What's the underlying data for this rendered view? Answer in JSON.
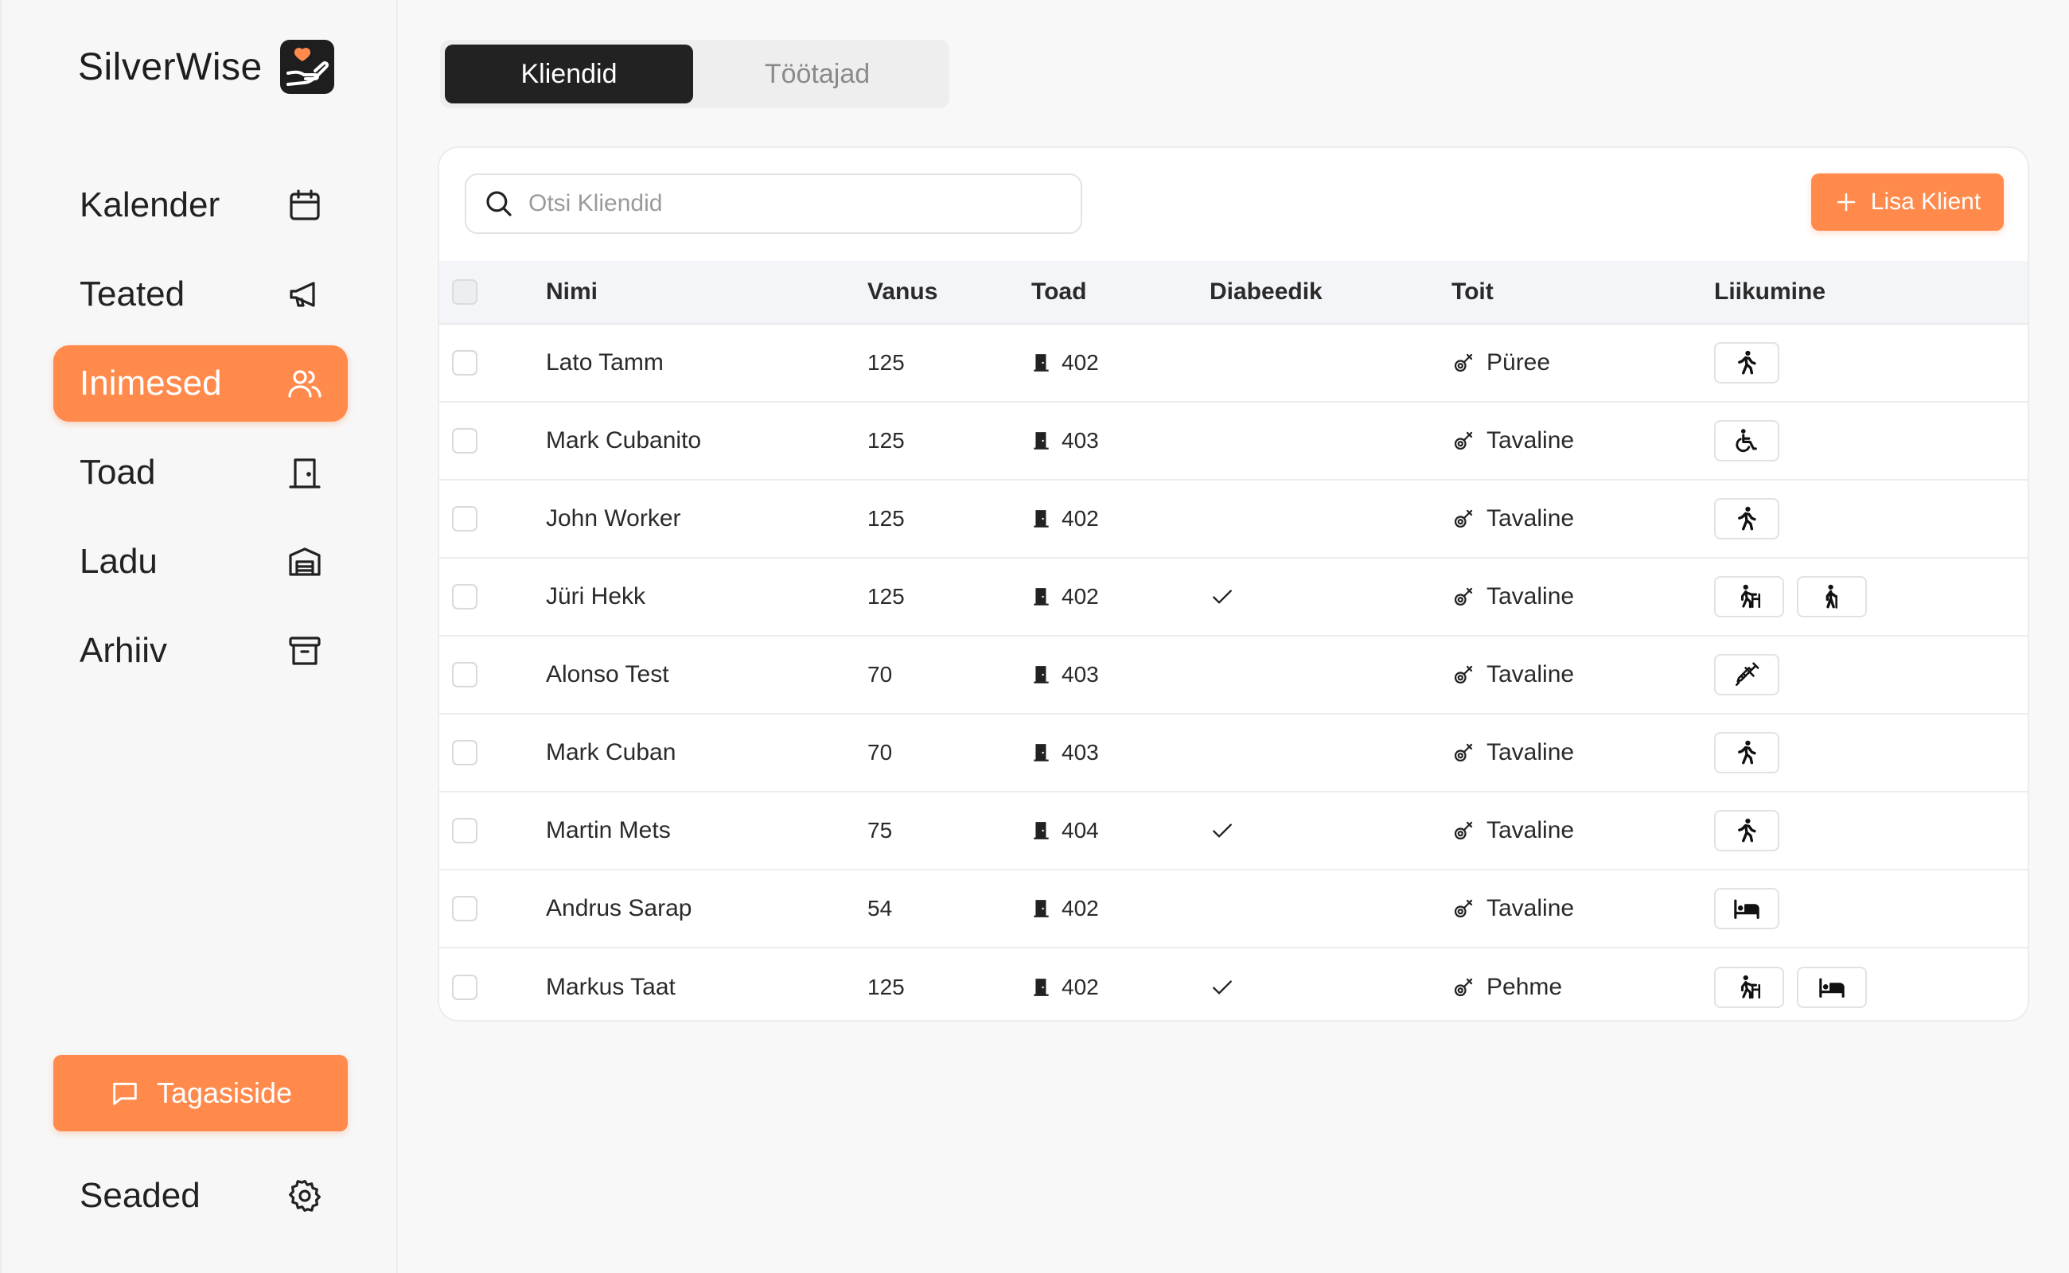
{
  "brand": {
    "name": "SilverWise"
  },
  "nav": [
    {
      "label": "Kalender",
      "icon": "calendar-icon"
    },
    {
      "label": "Teated",
      "icon": "megaphone-icon"
    },
    {
      "label": "Inimesed",
      "icon": "users-icon",
      "active": true
    },
    {
      "label": "Toad",
      "icon": "door-icon"
    },
    {
      "label": "Ladu",
      "icon": "warehouse-icon"
    },
    {
      "label": "Arhiiv",
      "icon": "archive-icon"
    }
  ],
  "feedback": {
    "label": "Tagasiside",
    "icon": "message-icon"
  },
  "settings": {
    "label": "Seaded",
    "icon": "gear-icon"
  },
  "tabs": [
    {
      "label": "Kliendid",
      "active": true
    },
    {
      "label": "Töötajad",
      "active": false
    }
  ],
  "search": {
    "placeholder": "Otsi Kliendid",
    "value": ""
  },
  "add_button": {
    "label": "Lisa Klient"
  },
  "table": {
    "headers": {
      "name": "Nimi",
      "age": "Vanus",
      "room": "Toad",
      "diabetic": "Diabeedik",
      "food": "Toit",
      "mobility": "Liikumine"
    },
    "rows": [
      {
        "name": "Lato Tamm",
        "age": "125",
        "room": "402",
        "diabetic": false,
        "food": "Püree",
        "mobility": [
          "walking-icon"
        ]
      },
      {
        "name": "Mark Cubanito",
        "age": "125",
        "room": "403",
        "diabetic": false,
        "food": "Tavaline",
        "mobility": [
          "wheelchair-icon"
        ]
      },
      {
        "name": "John Worker",
        "age": "125",
        "room": "402",
        "diabetic": false,
        "food": "Tavaline",
        "mobility": [
          "walking-icon"
        ]
      },
      {
        "name": "Jüri Hekk",
        "age": "125",
        "room": "402",
        "diabetic": true,
        "food": "Tavaline",
        "mobility": [
          "walker-icon",
          "cane-icon"
        ]
      },
      {
        "name": "Alonso Test",
        "age": "70",
        "room": "403",
        "diabetic": false,
        "food": "Tavaline",
        "mobility": [
          "syringe-icon"
        ]
      },
      {
        "name": "Mark Cuban",
        "age": "70",
        "room": "403",
        "diabetic": false,
        "food": "Tavaline",
        "mobility": [
          "walking-icon"
        ]
      },
      {
        "name": "Martin Mets",
        "age": "75",
        "room": "404",
        "diabetic": true,
        "food": "Tavaline",
        "mobility": [
          "walking-icon"
        ]
      },
      {
        "name": "Andrus Sarap",
        "age": "54",
        "room": "402",
        "diabetic": false,
        "food": "Tavaline",
        "mobility": [
          "bed-icon"
        ]
      },
      {
        "name": "Markus Taat",
        "age": "125",
        "room": "402",
        "diabetic": true,
        "food": "Pehme",
        "mobility": [
          "walker-icon",
          "bed-icon"
        ]
      }
    ]
  },
  "colors": {
    "accent": "#ff8a4c",
    "dark": "#222222",
    "border": "#ececec",
    "header_bg": "#f3f5f8"
  }
}
